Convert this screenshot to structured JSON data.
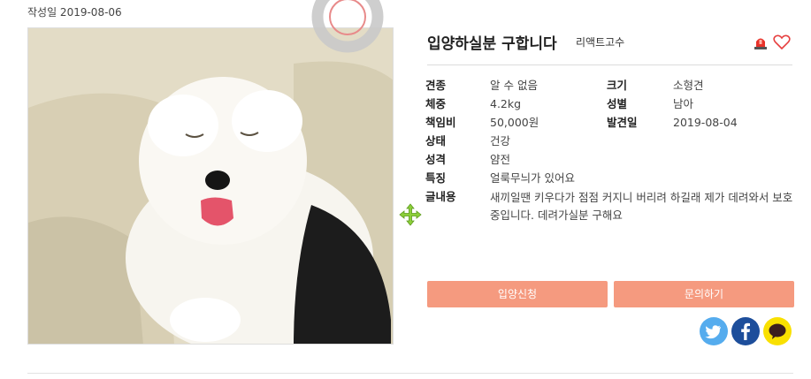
{
  "post": {
    "date": "작성일 2019-08-06",
    "title": "입양하실분 구합니다",
    "author": "리액트고수"
  },
  "icons": {
    "siren": "siren-report-icon",
    "heart": "heart-outline-icon",
    "move": "move-cursor-icon"
  },
  "details": {
    "breed_label": "견종",
    "breed": "알 수 없음",
    "size_label": "크기",
    "size": "소형견",
    "weight_label": "체중",
    "weight": "4.2kg",
    "gender_label": "성별",
    "gender": "남아",
    "fee_label": "책임비",
    "fee": "50,000원",
    "found_label": "발견일",
    "found": "2019-08-04",
    "health_label": "상태",
    "health": "건강",
    "temper_label": "성격",
    "temper": "얌전",
    "feature_label": "특징",
    "feature": "얼룩무늬가 있어요",
    "content_label": "글내용",
    "content": "새끼일땐 키우다가 점점 커지니 버리려 하길래 제가 데려와서 보호중입니다. 데려가실분 구해요"
  },
  "actions": {
    "adopt": "입양신청",
    "inquiry": "문의하기"
  },
  "share": {
    "twitter": "twitter-icon",
    "facebook": "facebook-icon",
    "kakao": "kakaotalk-icon"
  },
  "colors": {
    "button": "#f59a7f",
    "twitter": "#55acee",
    "facebook": "#1d4e9b",
    "kakao": "#f9e000",
    "heart": "#e63e3e"
  }
}
